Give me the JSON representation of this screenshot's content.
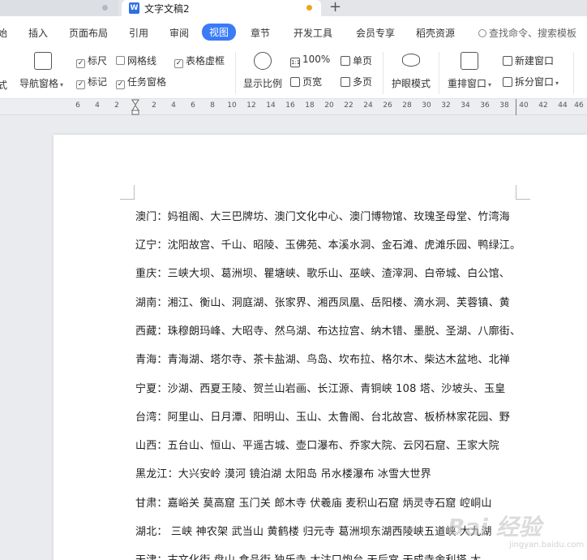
{
  "tabs": {
    "active_title": "文字文稿2",
    "doc_icon_letter": "W",
    "new_tab_label": "+"
  },
  "menu": {
    "items": [
      "始",
      "插入",
      "页面布局",
      "引用",
      "审阅",
      "视图",
      "章节",
      "开发工具",
      "会员专享",
      "稻壳资源"
    ],
    "active": "视图",
    "search_label": "查找命令、搜索模板"
  },
  "ribbon": {
    "nav_pane": "导航窗格",
    "ruler": "标尺",
    "gridlines": "网格线",
    "table_gridlines": "表格虚框",
    "marks": "标记",
    "task_pane": "任务窗格",
    "zoom_label": "显示比例",
    "zoom_100": "100%",
    "page_width": "页宽",
    "single_page": "单页",
    "multi_page": "多页",
    "eye_mode": "护眼模式",
    "rearrange_windows": "重排窗口",
    "new_window": "新建窗口",
    "split_window": "拆分窗口",
    "checked": {
      "ruler": true,
      "gridlines": false,
      "table_gridlines": true,
      "marks": true,
      "task_pane": true
    }
  },
  "ruler": {
    "ticks": [
      "6",
      "4",
      "2",
      "2",
      "4",
      "6",
      "8",
      "10",
      "12",
      "14",
      "16",
      "18",
      "20",
      "22",
      "24",
      "26",
      "28",
      "30",
      "32",
      "34",
      "36",
      "38",
      "40",
      "42",
      "44",
      "46"
    ]
  },
  "document": {
    "lines": [
      "澳门：妈祖阁、大三巴牌坊、澳门文化中心、澳门博物馆、玫瑰圣母堂、竹湾海",
      "辽宁：沈阳故宫、千山、昭陵、玉佛苑、本溪水洞、金石滩、虎滩乐园、鸭绿江。",
      "重庆：三峡大坝、葛洲坝、瞿塘峡、歌乐山、巫峡、渣滓洞、白帝城、白公馆、",
      "湖南：湘江、衡山、洞庭湖、张家界、湘西凤凰、岳阳楼、滴水洞、芙蓉镇、黄",
      "西藏：珠穆朗玛峰、大昭寺、然乌湖、布达拉宫、纳木错、墨脱、圣湖、八廓街、",
      "青海：青海湖、塔尔寺、茶卡盐湖、鸟岛、坎布拉、格尔木、柴达木盆地、北禅",
      "宁夏：沙湖、西夏王陵、贺兰山岩画、长江源、青铜峡 108 塔、沙坡头、玉皇",
      "台湾：阿里山、日月潭、阳明山、玉山、太鲁阁、台北故宫、板桥林家花园、野",
      "山西：五台山、恒山、平遥古城、壶口瀑布、乔家大院、云冈石窟、王家大院",
      "黑龙江：大兴安岭  漠河  镜泊湖  太阳岛  吊水楼瀑布  冰雪大世界",
      "甘肃：嘉峪关  莫高窟  玉门关  郎木寺  伏羲庙  麦积山石窟  炳灵寺石窟  崆峒山",
      "湖北：  三峡  神农架  武当山  黄鹤楼  归元寺  葛洲坝东湖西陵峡五道峡  大九湖",
      "天津：古文化街  盘山  食品街  独乐寺  大沽口炮台  天后宫  天成寺舍利塔  大"
    ]
  },
  "watermark": {
    "text": "Bai 经验",
    "sub": "jingyan.baidu.com"
  }
}
